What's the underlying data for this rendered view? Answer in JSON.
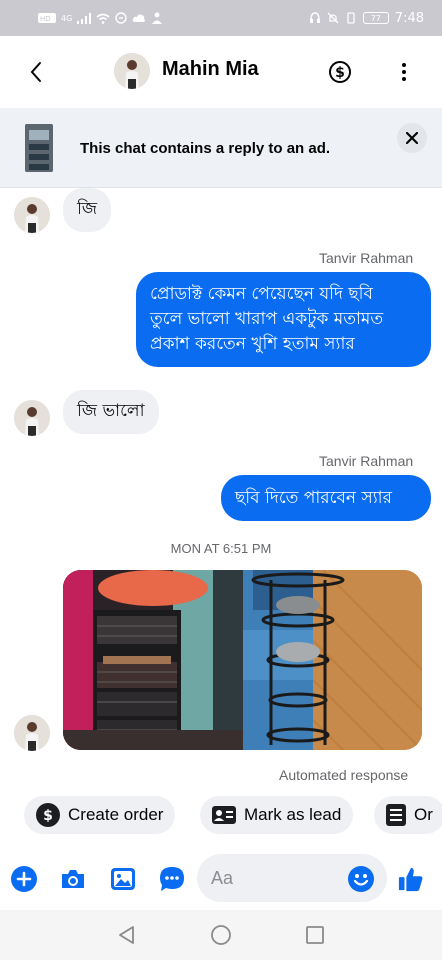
{
  "status_bar": {
    "time": "7:48",
    "network": "4G",
    "battery": "77"
  },
  "header": {
    "contact_name": "Mahin Mia",
    "icons": {
      "back": "chevron-left-icon",
      "payment": "dollar-circle-icon",
      "more": "more-vertical-icon"
    }
  },
  "ad_banner": {
    "text": "This chat contains a reply to an ad.",
    "close_icon": "close-icon"
  },
  "messages": [
    {
      "direction": "in",
      "text": "জি"
    },
    {
      "direction": "out",
      "sender": "Tanvir Rahman",
      "lines": [
        "প্রোডাক্ট কেমন পেয়েছেন যদি ছবি",
        "তুলে ভালো খারাপ একটুক মতামত",
        "প্রকাশ করতেন খুশি হতাম স্যার"
      ]
    },
    {
      "direction": "in",
      "text": "জি ভালো"
    },
    {
      "direction": "out",
      "sender": "Tanvir Rahman",
      "lines": [
        "ছবি দিতে পারবেন স্যার"
      ]
    }
  ],
  "timestamp": "MON AT 6:51 PM",
  "automated_label": "Automated response",
  "quick_actions": [
    {
      "label": "Create order",
      "icon": "dollar-circle-icon"
    },
    {
      "label": "Mark as lead",
      "icon": "contact-card-icon"
    },
    {
      "label": "Or",
      "icon": "list-icon"
    }
  ],
  "composer": {
    "placeholder": "Aa",
    "icons": [
      "plus-icon",
      "camera-icon",
      "image-icon",
      "chat-icon",
      "emoji-icon",
      "thumbs-up-icon"
    ]
  },
  "colors": {
    "accent": "#0a6cf0",
    "incoming_bubble": "#eef0f3",
    "status_bar": "#c9c9cf"
  }
}
